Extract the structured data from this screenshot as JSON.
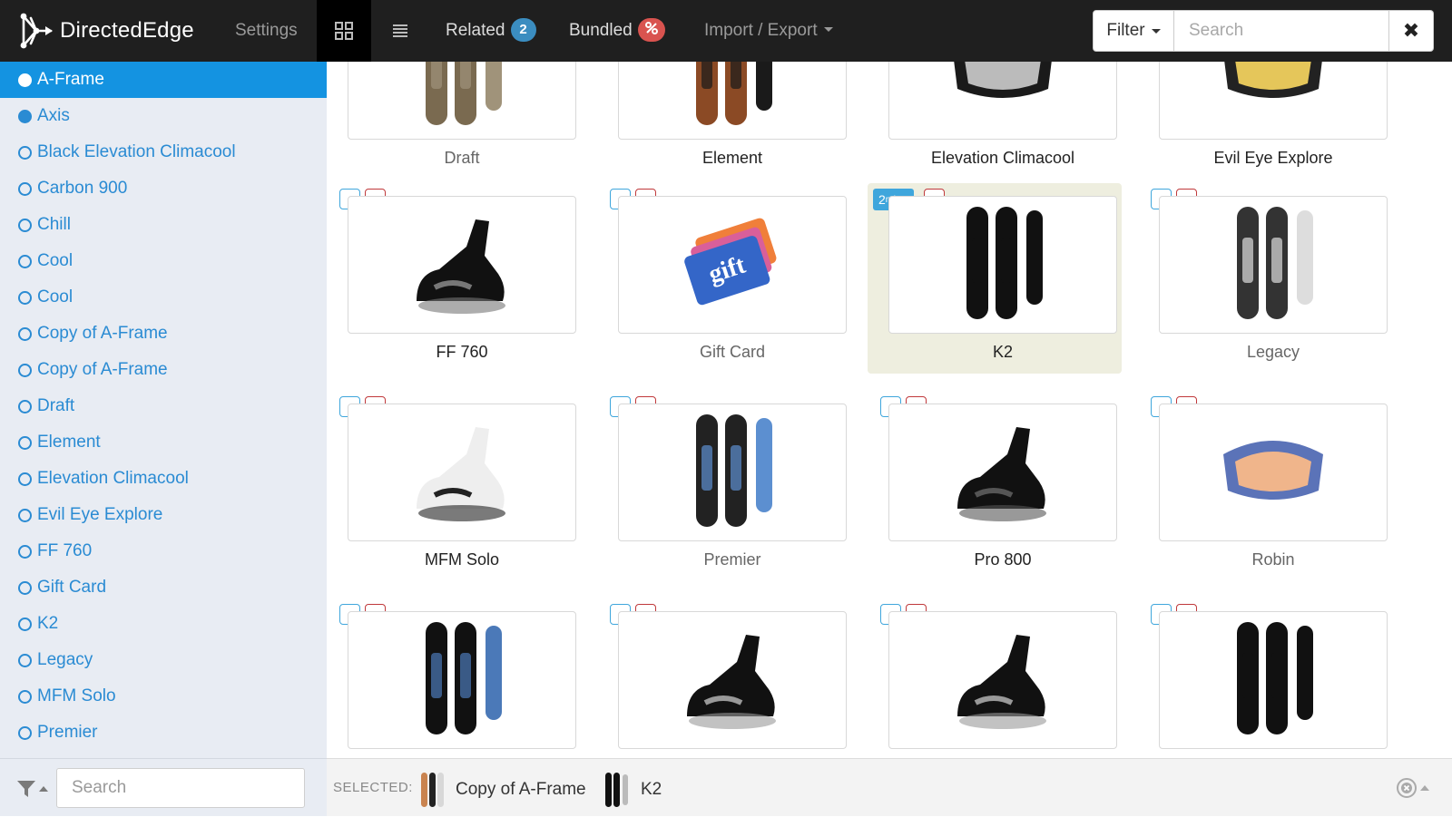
{
  "app": {
    "brand": "DirectedEdge"
  },
  "nav": {
    "settings": "Settings",
    "related_label": "Related",
    "related_count": "2",
    "bundled_label": "Bundled",
    "import_export": "Import / Export"
  },
  "topsearch": {
    "filter_label": "Filter",
    "placeholder": "Search",
    "clear": "✖"
  },
  "sidebar": {
    "items": [
      {
        "label": "A-Frame",
        "state": "active"
      },
      {
        "label": "Axis",
        "state": "filled"
      },
      {
        "label": "Black Elevation Climacool",
        "state": "empty"
      },
      {
        "label": "Carbon 900",
        "state": "empty"
      },
      {
        "label": "Chill",
        "state": "empty"
      },
      {
        "label": "Cool",
        "state": "empty"
      },
      {
        "label": "Cool",
        "state": "empty"
      },
      {
        "label": "Copy of A-Frame",
        "state": "empty"
      },
      {
        "label": "Copy of A-Frame",
        "state": "empty"
      },
      {
        "label": "Draft",
        "state": "empty"
      },
      {
        "label": "Element",
        "state": "empty"
      },
      {
        "label": "Elevation Climacool",
        "state": "empty"
      },
      {
        "label": "Evil Eye Explore",
        "state": "empty"
      },
      {
        "label": "FF 760",
        "state": "empty"
      },
      {
        "label": "Gift Card",
        "state": "empty"
      },
      {
        "label": "K2",
        "state": "empty"
      },
      {
        "label": "Legacy",
        "state": "empty"
      },
      {
        "label": "MFM Solo",
        "state": "empty"
      },
      {
        "label": "Premier",
        "state": "empty"
      }
    ],
    "search_placeholder": "Search"
  },
  "grid": {
    "products": [
      {
        "name": "Draft",
        "image": "snowboard-icon",
        "muted": true
      },
      {
        "name": "Element",
        "image": "snowboard-icon",
        "muted": false
      },
      {
        "name": "Elevation Climacool",
        "image": "goggles-icon",
        "muted": false
      },
      {
        "name": "Evil Eye Explore",
        "image": "goggles-icon",
        "muted": false
      },
      {
        "name": "FF 760",
        "image": "binding-icon",
        "muted": false
      },
      {
        "name": "Gift Card",
        "image": "gift-card-icon",
        "muted": true
      },
      {
        "name": "K2",
        "image": "snowboard-icon",
        "muted": false,
        "rank": "2",
        "rank_suffix": "nd"
      },
      {
        "name": "Legacy",
        "image": "snowboard-icon",
        "muted": true
      },
      {
        "name": "MFM Solo",
        "image": "binding-icon",
        "muted": false
      },
      {
        "name": "Premier",
        "image": "snowboard-icon",
        "muted": true
      },
      {
        "name": "Pro 800",
        "image": "binding-icon",
        "muted": false
      },
      {
        "name": "Robin",
        "image": "goggles-icon",
        "muted": true
      },
      {
        "name": "",
        "image": "snowboard-icon",
        "muted": false
      },
      {
        "name": "",
        "image": "binding-icon",
        "muted": false
      },
      {
        "name": "",
        "image": "binding-icon",
        "muted": false
      },
      {
        "name": "",
        "image": "snowboard-icon",
        "muted": false
      }
    ]
  },
  "selected": {
    "label": "SELECTED:",
    "items": [
      {
        "name": "Copy of A-Frame",
        "image": "snowboard-icon"
      },
      {
        "name": "K2",
        "image": "snowboard-icon"
      }
    ]
  },
  "colors": {
    "topbar": "#1f1f1f",
    "sidebar_bg": "#e8ecf3",
    "active_item": "#1493e1",
    "link_blue": "#2a8bd3",
    "badge_blue": "#3b8dc0",
    "badge_red": "#d9534f",
    "highlight_cell": "#eeeedf"
  }
}
